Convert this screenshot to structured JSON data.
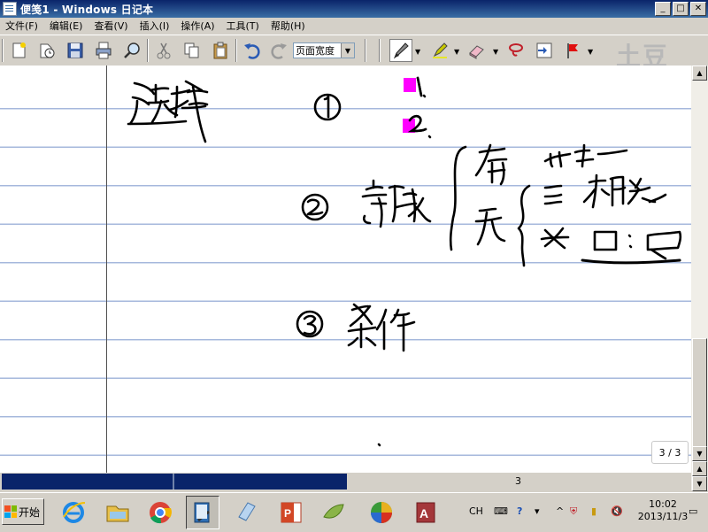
{
  "window": {
    "title": "便笺1 - Windows 日记本",
    "controls": [
      "_",
      "□",
      "✕"
    ]
  },
  "menu": [
    "文件(F)",
    "编辑(E)",
    "查看(V)",
    "插入(I)",
    "操作(A)",
    "工具(T)",
    "帮助(H)"
  ],
  "toolbar": {
    "zoom_value": "页面宽度",
    "watermark": "土豆",
    "tools": [
      "new-icon",
      "open-icon",
      "save-icon",
      "print-icon",
      "find-icon",
      "cut-icon",
      "copy-icon",
      "paste-icon",
      "undo-icon",
      "redo-icon",
      "pen-icon",
      "highlighter-icon",
      "eraser-icon",
      "lasso-icon",
      "insert-space-icon",
      "flag-icon"
    ]
  },
  "note": {
    "page_counter": "3 / 3",
    "ink_color": "#000000",
    "highlight_color": "#ff00ff",
    "line_color": "#a6b8dc"
  },
  "statusbar": {
    "page_number": "3"
  },
  "taskbar": {
    "start_label": "开始",
    "apps": [
      "ie-icon",
      "explorer-icon",
      "chrome-icon",
      "journal-icon",
      "notepad-icon",
      "powerpoint-icon",
      "green-app-icon",
      "ball-app-icon",
      "access-icon"
    ],
    "input_language": "CH",
    "time": "10:02",
    "date": "2013/11/3"
  }
}
